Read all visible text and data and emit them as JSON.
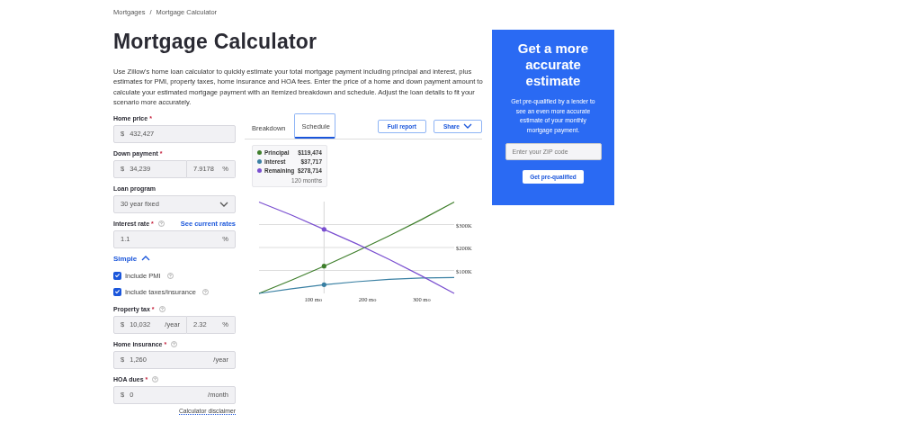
{
  "breadcrumb": {
    "items": [
      "Mortgages",
      "Mortgage Calculator"
    ],
    "separator": "/"
  },
  "title": "Mortgage Calculator",
  "description": "Use Zillow's home loan calculator to quickly estimate your total mortgage payment including principal and interest, plus estimates for PMI, property taxes, home insurance and HOA fees. Enter the price of a home and down payment amount to calculate your estimated mortgage payment with an itemized breakdown and schedule. Adjust the loan details to fit your scenario more accurately.",
  "form": [
    {
      "kind": "money",
      "label": "Home price",
      "mark": "*",
      "prefix": "$",
      "value": "432,427"
    },
    {
      "kind": "money",
      "label": "Down payment",
      "mark": "*",
      "prefix": "$",
      "value": "34,239",
      "percent": "7.9178",
      "percent_suffix": "%"
    },
    {
      "kind": "select",
      "label": "Loan program",
      "value": "30 year fixed"
    },
    {
      "kind": "money",
      "label": "Interest rate",
      "mark": "*",
      "help": true,
      "link": "See current rates",
      "value": "1.1",
      "suffix": "%"
    },
    {
      "kind": "toggle",
      "label": "Simple",
      "expanded": true
    },
    {
      "kind": "checkbox",
      "label": "Include PMI",
      "checked": true,
      "help": true
    },
    {
      "kind": "checkbox",
      "label": "Include taxes/insurance",
      "checked": true,
      "help": true
    },
    {
      "kind": "money",
      "label": "Property tax",
      "mark": "*",
      "help": true,
      "prefix": "$",
      "value": "10,032",
      "suffix": "/year",
      "percent": "2.32",
      "percent_suffix": "%"
    },
    {
      "kind": "money",
      "label": "Home insurance",
      "mark": "*",
      "help": true,
      "prefix": "$",
      "value": "1,260",
      "suffix": "/year"
    },
    {
      "kind": "money",
      "label": "HOA dues",
      "mark": "*",
      "help": true,
      "prefix": "$",
      "value": "0",
      "suffix": "/month"
    },
    {
      "kind": "link",
      "label": "Calculator disclaimer"
    }
  ],
  "tabs": [
    {
      "label": "Breakdown",
      "selected": false
    },
    {
      "label": "Schedule",
      "selected": true
    }
  ],
  "actions": [
    {
      "label": "Full report",
      "dropdown": false
    },
    {
      "label": "Share",
      "dropdown": true
    }
  ],
  "legend_values": [
    "$119,474",
    "$37,717",
    "$278,714"
  ],
  "chart_data": {
    "type": "line",
    "grid": true,
    "x": [
      0,
      60,
      120,
      180,
      240,
      300,
      360
    ],
    "series": [
      {
        "name": "Principal",
        "color": "#3f7f2c",
        "values": [
          0,
          58000,
          119000,
          183000,
          251000,
          322000,
          398000
        ]
      },
      {
        "name": "Interest",
        "color": "#3a80a3",
        "values": [
          0,
          20000,
          38000,
          51000,
          61000,
          67000,
          69000
        ]
      },
      {
        "name": "Remaining",
        "color": "#7a4fd0",
        "values": [
          398000,
          341000,
          279000,
          216000,
          148000,
          76000,
          0
        ]
      }
    ],
    "xlim": [
      0,
      360
    ],
    "ylim": [
      0,
      400000
    ],
    "xticks": [
      {
        "value": 100,
        "label": "100 mo"
      },
      {
        "value": 200,
        "label": "200 mo"
      },
      {
        "value": 300,
        "label": "300 mo"
      }
    ],
    "yticks": [
      {
        "value": 100000,
        "label": "$100K"
      },
      {
        "value": 200000,
        "label": "$200K"
      },
      {
        "value": 300000,
        "label": "$300K"
      }
    ],
    "legend": "top-left",
    "ref_lines": [
      {
        "axis": "x",
        "value": 120
      }
    ],
    "annotations": [
      "120 months"
    ]
  },
  "promo": {
    "title": "Get a more accurate estimate",
    "text": "Get pre-qualified by a lender to see an even more accurate estimate of your monthly mortgage payment.",
    "placeholder": "Enter your ZIP code",
    "button": "Get pre-qualified"
  }
}
